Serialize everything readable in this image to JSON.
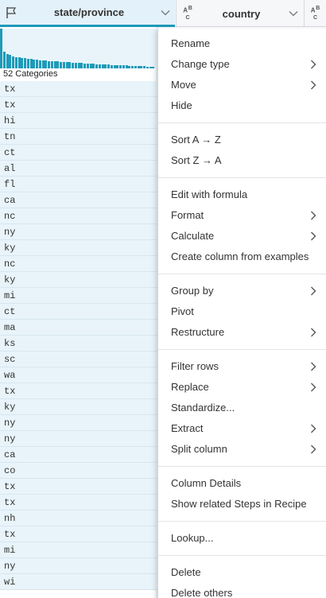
{
  "header": {
    "columns": [
      {
        "title": "state/province",
        "type_icon": "flag-icon",
        "active": true
      },
      {
        "title": "country",
        "type_icon": "abc-string-icon"
      },
      {
        "title": "",
        "type_icon": "abc-string-icon"
      }
    ]
  },
  "histogram": {
    "categories_label": "52 Categories",
    "bar_fractions": [
      1.0,
      0.42,
      0.36,
      0.33,
      0.3,
      0.28,
      0.27,
      0.26,
      0.25,
      0.24,
      0.23,
      0.22,
      0.21,
      0.2,
      0.2,
      0.19,
      0.18,
      0.18,
      0.17,
      0.17,
      0.16,
      0.16,
      0.15,
      0.15,
      0.14,
      0.14,
      0.13,
      0.13,
      0.12,
      0.12,
      0.11,
      0.11,
      0.1,
      0.1,
      0.1,
      0.09,
      0.09,
      0.08,
      0.08,
      0.08,
      0.07,
      0.07,
      0.07,
      0.06,
      0.06,
      0.06,
      0.05,
      0.05,
      0.05,
      0.04,
      0.04,
      0.04
    ],
    "color": "#1e9ab8"
  },
  "rows": [
    "tx",
    "tx",
    "hi",
    "tn",
    "ct",
    "al",
    "fl",
    "ca",
    "nc",
    "ny",
    "ky",
    "nc",
    "ky",
    "mi",
    "ct",
    "ma",
    "ks",
    "sc",
    "wa",
    "tx",
    "ky",
    "ny",
    "ny",
    "ca",
    "co",
    "tx",
    "tx",
    "nh",
    "tx",
    "mi",
    "ny",
    "wi"
  ],
  "menu": {
    "groups": [
      [
        {
          "label": "Rename",
          "submenu": false
        },
        {
          "label": "Change type",
          "submenu": true
        },
        {
          "label": "Move",
          "submenu": true
        },
        {
          "label": "Hide",
          "submenu": false
        }
      ],
      [
        {
          "label": "Sort A → Z",
          "submenu": false
        },
        {
          "label": "Sort Z → A",
          "submenu": false
        }
      ],
      [
        {
          "label": "Edit with formula",
          "submenu": false
        },
        {
          "label": "Format",
          "submenu": true
        },
        {
          "label": "Calculate",
          "submenu": true
        },
        {
          "label": "Create column from examples",
          "submenu": false
        }
      ],
      [
        {
          "label": "Group by",
          "submenu": true
        },
        {
          "label": "Pivot",
          "submenu": false
        },
        {
          "label": "Restructure",
          "submenu": true
        }
      ],
      [
        {
          "label": "Filter rows",
          "submenu": true
        },
        {
          "label": "Replace",
          "submenu": true
        },
        {
          "label": "Standardize...",
          "submenu": false
        },
        {
          "label": "Extract",
          "submenu": true
        },
        {
          "label": "Split column",
          "submenu": true
        }
      ],
      [
        {
          "label": "Column Details",
          "submenu": false
        },
        {
          "label": "Show related Steps in Recipe",
          "submenu": false
        }
      ],
      [
        {
          "label": "Lookup...",
          "submenu": false
        }
      ],
      [
        {
          "label": "Delete",
          "submenu": false
        },
        {
          "label": "Delete others",
          "submenu": false
        }
      ]
    ]
  }
}
